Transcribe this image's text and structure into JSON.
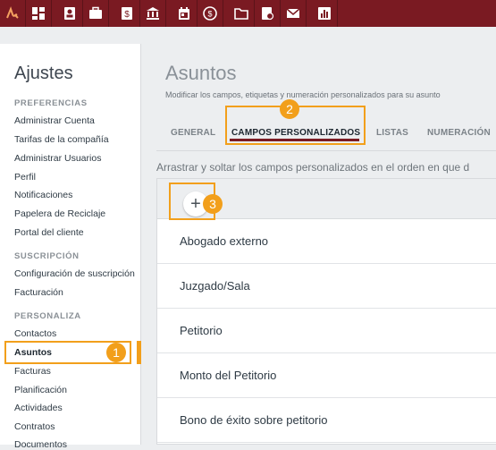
{
  "topbar": {
    "icons": [
      "logo-icon",
      "dashboard-icon",
      "contacts-icon",
      "briefcase-icon",
      "billing-icon",
      "bank-icon",
      "calendar-icon",
      "time-icon",
      "folder-icon",
      "document-icon",
      "mail-icon",
      "reports-icon"
    ]
  },
  "sidebar": {
    "title": "Ajustes",
    "sections": {
      "preferencias": "PREFERENCIAS",
      "suscripcion": "SUSCRIPCIÓN",
      "personaliza": "PERSONALIZA"
    },
    "items": [
      "Administrar Cuenta",
      "Tarifas de la compañía",
      "Administrar Usuarios",
      "Perfil",
      "Notificaciones",
      "Papelera de Reciclaje",
      "Portal del cliente",
      "Configuración de suscripción",
      "Facturación",
      "Contactos",
      "Asuntos",
      "Facturas",
      "Planificación",
      "Actividades",
      "Contratos",
      "Documentos"
    ]
  },
  "main": {
    "title": "Asuntos",
    "subtitle": "Modificar los campos, etiquetas y numeración personalizados para su asunto",
    "tabs": [
      "GENERAL",
      "CAMPOS PERSONALIZADOS",
      "LISTAS",
      "NUMERACIÓN"
    ],
    "drag_hint": "Arrastrar y soltar los campos personalizados en el orden en que d",
    "add_symbol": "+",
    "fields": [
      "Abogado externo",
      "Juzgado/Sala",
      "Petitorio",
      "Monto del Petitorio",
      "Bono de éxito sobre petitorio"
    ]
  },
  "badges": [
    "1",
    "2",
    "3"
  ],
  "colors": {
    "topbar": "#7a1a22",
    "highlight": "#f29f1b",
    "tab_underline": "#7a1a22"
  }
}
